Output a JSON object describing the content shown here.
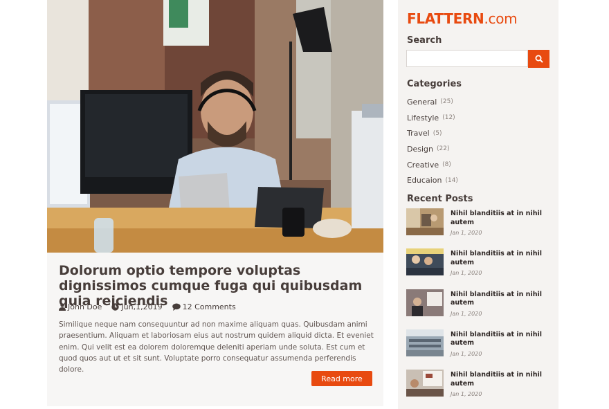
{
  "post": {
    "title": "Dolorum optio tempore voluptas dignissimos cumque fuga qui quibusdam quia reiciendis",
    "author": "John Doe",
    "date": "Jun,1,2019",
    "comments": "12 Comments",
    "excerpt": "Similique neque nam consequuntur ad non maxime aliquam quas. Quibusdam animi praesentium. Aliquam et laboriosam eius aut nostrum quidem aliquid dicta. Et eveniet enim. Qui velit est ea dolorem doloremque deleniti aperiam unde soluta. Est cum et quod quos aut ut et sit sunt. Voluptate porro consequatur assumenda perferendis dolore.",
    "read_more": "Read more"
  },
  "sidebar": {
    "logo_main": "FLATTERN",
    "logo_domain": ".com",
    "search_title": "Search",
    "search_value": "",
    "categories_title": "Categories",
    "categories": [
      {
        "name": "General",
        "count": "(25)"
      },
      {
        "name": "Lifestyle",
        "count": "(12)"
      },
      {
        "name": "Travel",
        "count": "(5)"
      },
      {
        "name": "Design",
        "count": "(22)"
      },
      {
        "name": "Creative",
        "count": "(8)"
      },
      {
        "name": "Educaion",
        "count": "(14)"
      }
    ],
    "recent_title": "Recent Posts",
    "recent_posts": [
      {
        "title": "Nihil blanditiis at in nihil autem",
        "date": "Jan 1, 2020"
      },
      {
        "title": "Nihil blanditiis at in nihil autem",
        "date": "Jan 1, 2020"
      },
      {
        "title": "Nihil blanditiis at in nihil autem",
        "date": "Jan 1, 2020"
      },
      {
        "title": "Nihil blanditiis at in nihil autem",
        "date": "Jan 1, 2020"
      },
      {
        "title": "Nihil blanditiis at in nihil autem",
        "date": "Jan 1, 2020"
      }
    ]
  },
  "colors": {
    "accent": "#e84a10",
    "heading": "#473d3a",
    "card_bg": "#f7f6f5"
  }
}
